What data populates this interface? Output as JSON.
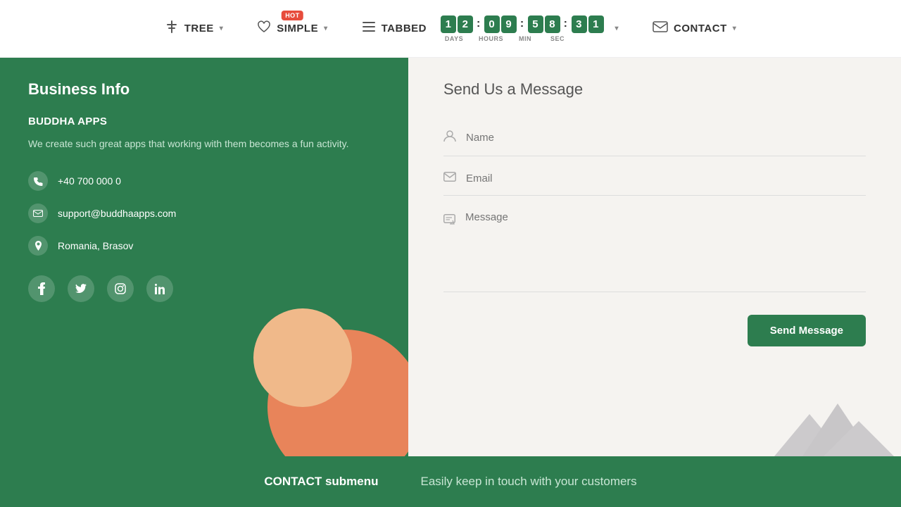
{
  "navbar": {
    "items": [
      {
        "id": "tree",
        "label": "TREE",
        "icon": "⊞",
        "has_chevron": true
      },
      {
        "id": "simple",
        "label": "SIMPLE",
        "icon": "♡",
        "has_chevron": true,
        "badge": "HOT"
      },
      {
        "id": "tabbed",
        "label": "TABBED",
        "icon": "☰",
        "has_chevron": false
      },
      {
        "id": "contact",
        "label": "CONTACT",
        "icon": "✉",
        "has_chevron": true
      }
    ],
    "countdown": {
      "days": [
        "1",
        "2"
      ],
      "hours": [
        "0",
        "9"
      ],
      "minutes": [
        "5",
        "8"
      ],
      "seconds": [
        "3",
        "1"
      ],
      "labels": [
        "DAYS",
        "HOURS",
        "MIN",
        "SEC"
      ]
    }
  },
  "left_panel": {
    "title": "Business Info",
    "company_name": "BUDDHA APPS",
    "description": "We create such great apps that working with them becomes a fun activity.",
    "phone": "+40 700 000 0",
    "email": "support@buddhaapps.com",
    "address": "Romania, Brasov",
    "social": [
      "f",
      "t",
      "in",
      "in"
    ]
  },
  "right_panel": {
    "title": "Send Us a Message",
    "name_placeholder": "Name",
    "email_placeholder": "Email",
    "message_placeholder": "Message",
    "send_label": "Send Message"
  },
  "footer": {
    "left_text": "CONTACT submenu",
    "right_text": "Easily keep in touch with your customers"
  },
  "colors": {
    "green": "#2d7d4f",
    "orange": "#e8845a",
    "peach": "#f0b98a"
  }
}
